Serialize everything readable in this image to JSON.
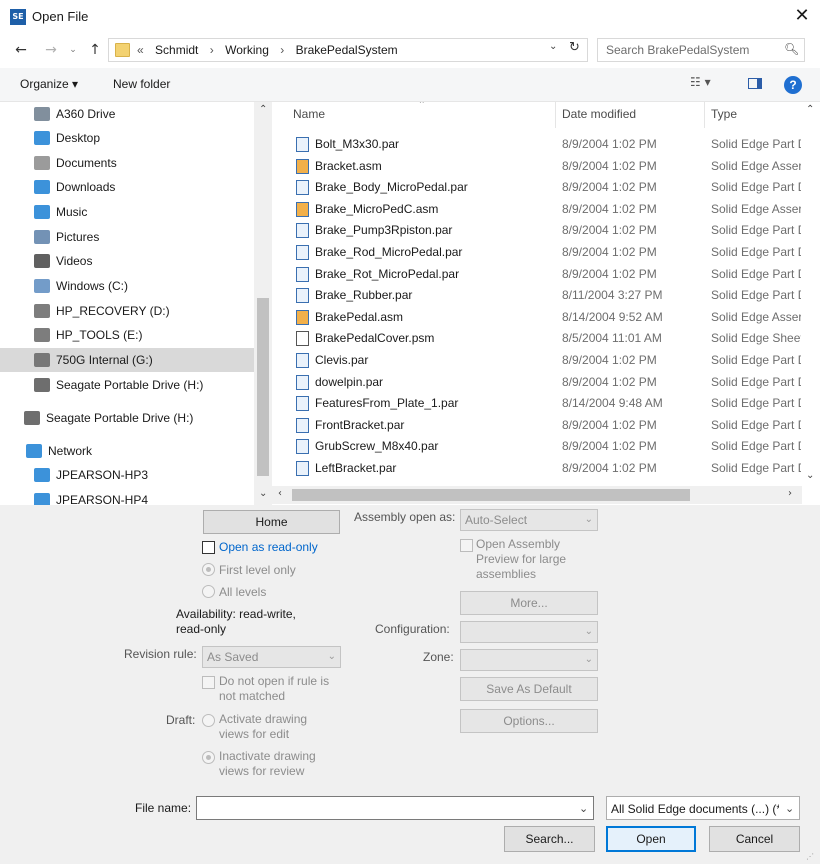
{
  "window": {
    "title": "Open File",
    "app_icon_text": "SE",
    "close_glyph": "✕"
  },
  "address": {
    "breadcrumb": [
      "«",
      "Schmidt",
      "›",
      "Working",
      "›",
      "BrakePedalSystem"
    ],
    "search_placeholder": "Search BrakePedalSystem"
  },
  "toolbar": {
    "organize_label": "Organize ▾",
    "new_folder_label": "New folder",
    "help_label": "?"
  },
  "nav": {
    "items": [
      {
        "label": "A360 Drive",
        "icon": "cloud-icon",
        "color": "#6b7b8c"
      },
      {
        "label": "Desktop",
        "icon": "desktop-icon",
        "color": "#1a7fd4"
      },
      {
        "label": "Documents",
        "icon": "documents-icon",
        "color": "#8a8a8a"
      },
      {
        "label": "Downloads",
        "icon": "downloads-icon",
        "color": "#1a7fd4"
      },
      {
        "label": "Music",
        "icon": "music-icon",
        "color": "#1a7fd4"
      },
      {
        "label": "Pictures",
        "icon": "pictures-icon",
        "color": "#5a7fa8"
      },
      {
        "label": "Videos",
        "icon": "videos-icon",
        "color": "#444"
      },
      {
        "label": "Windows (C:)",
        "icon": "drive-windows-icon",
        "color": "#5b8bc0"
      },
      {
        "label": "HP_RECOVERY (D:)",
        "icon": "drive-icon",
        "color": "#666"
      },
      {
        "label": "HP_TOOLS (E:)",
        "icon": "drive-icon",
        "color": "#666"
      },
      {
        "label": "750G Internal (G:)",
        "icon": "drive-icon",
        "color": "#666"
      },
      {
        "label": "Seagate Portable Drive (H:)",
        "icon": "drive-icon",
        "color": "#555"
      },
      {
        "label": "Seagate Portable Drive (H:)",
        "icon": "drive-icon",
        "color": "#555"
      },
      {
        "label": "Network",
        "icon": "network-icon",
        "color": "#1a7fd4"
      },
      {
        "label": "JPEARSON-HP3",
        "icon": "computer-icon",
        "color": "#1a7fd4"
      },
      {
        "label": "JPEARSON-HP4",
        "icon": "computer-icon",
        "color": "#1a7fd4"
      }
    ]
  },
  "list": {
    "columns": {
      "name": "Name",
      "date": "Date modified",
      "type": "Type"
    },
    "files": [
      {
        "name": "Bolt_M3x30.par",
        "date": "8/9/2004 1:02 PM",
        "type": "Solid Edge Part D",
        "kind": "par"
      },
      {
        "name": "Bracket.asm",
        "date": "8/9/2004 1:02 PM",
        "type": "Solid Edge Asser",
        "kind": "asm"
      },
      {
        "name": "Brake_Body_MicroPedal.par",
        "date": "8/9/2004 1:02 PM",
        "type": "Solid Edge Part D",
        "kind": "par"
      },
      {
        "name": "Brake_MicroPedC.asm",
        "date": "8/9/2004 1:02 PM",
        "type": "Solid Edge Asser",
        "kind": "asm"
      },
      {
        "name": "Brake_Pump3Rpiston.par",
        "date": "8/9/2004 1:02 PM",
        "type": "Solid Edge Part D",
        "kind": "par"
      },
      {
        "name": "Brake_Rod_MicroPedal.par",
        "date": "8/9/2004 1:02 PM",
        "type": "Solid Edge Part D",
        "kind": "par"
      },
      {
        "name": "Brake_Rot_MicroPedal.par",
        "date": "8/9/2004 1:02 PM",
        "type": "Solid Edge Part D",
        "kind": "par"
      },
      {
        "name": "Brake_Rubber.par",
        "date": "8/11/2004 3:27 PM",
        "type": "Solid Edge Part D",
        "kind": "par"
      },
      {
        "name": "BrakePedal.asm",
        "date": "8/14/2004 9:52 AM",
        "type": "Solid Edge Asser",
        "kind": "asm"
      },
      {
        "name": "BrakePedalCover.psm",
        "date": "8/5/2004 11:01 AM",
        "type": "Solid Edge Sheet",
        "kind": "psm"
      },
      {
        "name": "Clevis.par",
        "date": "8/9/2004 1:02 PM",
        "type": "Solid Edge Part D",
        "kind": "par"
      },
      {
        "name": "dowelpin.par",
        "date": "8/9/2004 1:02 PM",
        "type": "Solid Edge Part D",
        "kind": "par"
      },
      {
        "name": "FeaturesFrom_Plate_1.par",
        "date": "8/14/2004 9:48 AM",
        "type": "Solid Edge Part D",
        "kind": "par"
      },
      {
        "name": "FrontBracket.par",
        "date": "8/9/2004 1:02 PM",
        "type": "Solid Edge Part D",
        "kind": "par"
      },
      {
        "name": "GrubScrew_M8x40.par",
        "date": "8/9/2004 1:02 PM",
        "type": "Solid Edge Part D",
        "kind": "par"
      },
      {
        "name": "LeftBracket.par",
        "date": "8/9/2004 1:02 PM",
        "type": "Solid Edge Part D",
        "kind": "par"
      }
    ]
  },
  "options": {
    "home_label": "Home",
    "read_only_label": "Open as read-only",
    "first_level_label": "First level only",
    "all_levels_label": "All levels",
    "availability_label": "Availability: read-write,\nread-only",
    "revision_rule_label": "Revision rule:",
    "revision_rule_value": "As Saved",
    "no_open_label": "Do not open if rule is\nnot matched",
    "draft_label": "Draft:",
    "activate_label": "Activate drawing\nviews for edit",
    "inactivate_label": "Inactivate drawing\nviews for review",
    "assembly_open_as_label": "Assembly open as:",
    "assembly_open_as_value": "Auto-Select",
    "open_assembly_preview_label": "Open Assembly\nPreview for large\nassemblies",
    "more_label": "More...",
    "configuration_label": "Configuration:",
    "zone_label": "Zone:",
    "save_as_default_label": "Save As Default",
    "options_label": "Options..."
  },
  "footer": {
    "file_name_label": "File name:",
    "file_type_value": "All Solid Edge documents (...) (*",
    "search_label": "Search...",
    "open_label": "Open",
    "cancel_label": "Cancel"
  }
}
